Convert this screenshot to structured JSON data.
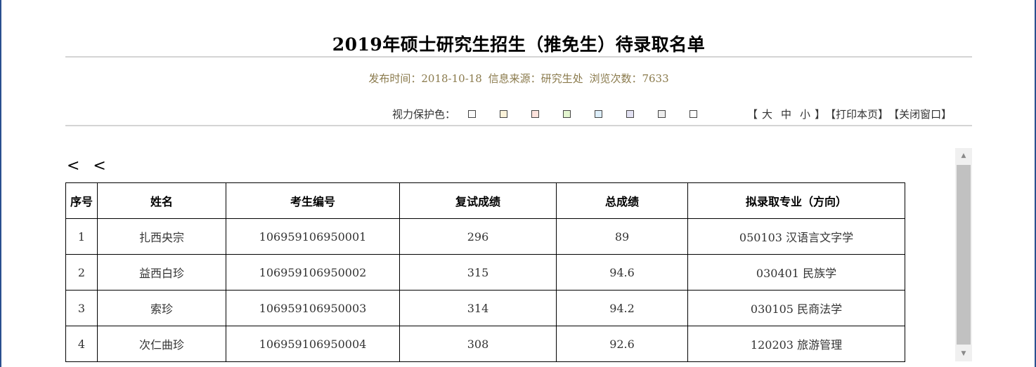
{
  "page": {
    "title": "2019年硕士研究生招生（推免生）待录取名单",
    "meta": {
      "publish_time": "发布时间：2018-10-18",
      "source": "信息来源：研究生处",
      "views": "浏览次数：7633"
    }
  },
  "eye_protection": {
    "label": "视力保护色：",
    "swatches": [
      "#fafafa",
      "#fbf2d9",
      "#fde2dc",
      "#e3f5cf",
      "#ddeefa",
      "#e2e1f2",
      "#ededed",
      "#ffffff"
    ]
  },
  "toolbar": {
    "size_open": "【",
    "size_large": "大",
    "size_medium": "中",
    "size_small": "小",
    "size_close": "】",
    "print": "【打印本页】",
    "close": "【关闭窗口】"
  },
  "nav": {
    "back": "< <"
  },
  "table": {
    "headers": [
      "序号",
      "姓名",
      "考生编号",
      "复试成绩",
      "总成绩",
      "拟录取专业（方向）"
    ],
    "rows": [
      [
        "1",
        "扎西央宗",
        "106959106950001",
        "296",
        "89",
        "050103 汉语言文字学"
      ],
      [
        "2",
        "益西白珍",
        "106959106950002",
        "315",
        "94.6",
        "030401 民族学"
      ],
      [
        "3",
        "索珍",
        "106959106950003",
        "314",
        "94.2",
        "030105 民商法学"
      ],
      [
        "4",
        "次仁曲珍",
        "106959106950004",
        "308",
        "92.6",
        "120203 旅游管理"
      ]
    ]
  },
  "scrollbar": {
    "up_arrow": "▲",
    "down_arrow": "▼"
  }
}
